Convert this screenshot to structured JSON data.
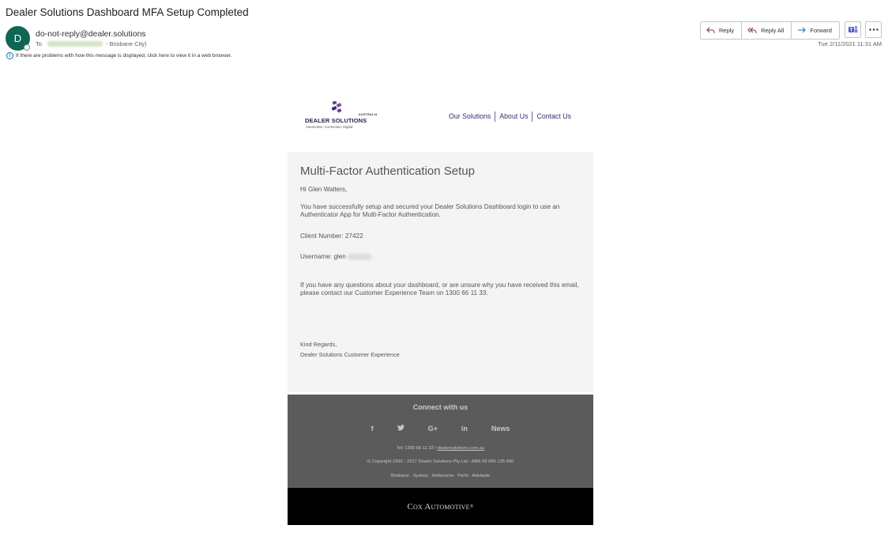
{
  "subject": "Dealer Solutions Dashboard MFA Setup Completed",
  "sender": {
    "initial": "D",
    "email": "do-not-reply@dealer.solutions",
    "to_label": "To",
    "to_suffix": "- Brisbane City)"
  },
  "info_bar": "If there are problems with how this message is displayed, click here to view it in a web browser.",
  "actions": {
    "reply": "Reply",
    "reply_all": "Reply All",
    "forward": "Forward"
  },
  "date": "Tue 2/11/2021 11:31 AM",
  "logo": {
    "name": "DEALER SOLUTIONS",
    "country": "AUSTRALIA",
    "tagline": "Automotive. Connected. Digital."
  },
  "nav": [
    "Our Solutions",
    "About Us",
    "Contact Us"
  ],
  "body": {
    "title": "Multi-Factor Authentication Setup",
    "greeting": "Hi Glen Walters,",
    "para1": "You have successfully setup and secured your Dealer Solutions Dashboard login to use an Authenticator App for Multi-Factor Authentication.",
    "client_number": "Client Number: 27422",
    "username": "Username: glen",
    "para2": "If you have any questions about your dashboard, or are unsure why you have received this email, please contact our Customer Experience Team on 1300 66 11 33.",
    "regards": "Kind Regards,",
    "signature": "Dealer Solutions Customer Experience"
  },
  "footer": {
    "connect": "Connect with us",
    "social": {
      "facebook": "f",
      "twitter": "🐦",
      "gplus": "G+",
      "linkedin": "in",
      "news": "News"
    },
    "tel": "Tel: 1300 66 11 33 |",
    "website": "dealersolutions.com.au",
    "copyright": "© Copyright 1992 - 2017 Dealer Solutions Pty Ltd - ABN 68 056 135 490",
    "locations": "Brisbane . Sydney . Melbourne . Perth . Adelaide"
  },
  "cox": "Cox Automotive",
  "colors": {
    "avatar": "#0e6655",
    "brand_purple": "#3b2a76",
    "footer_bg": "#5b5b5b"
  }
}
